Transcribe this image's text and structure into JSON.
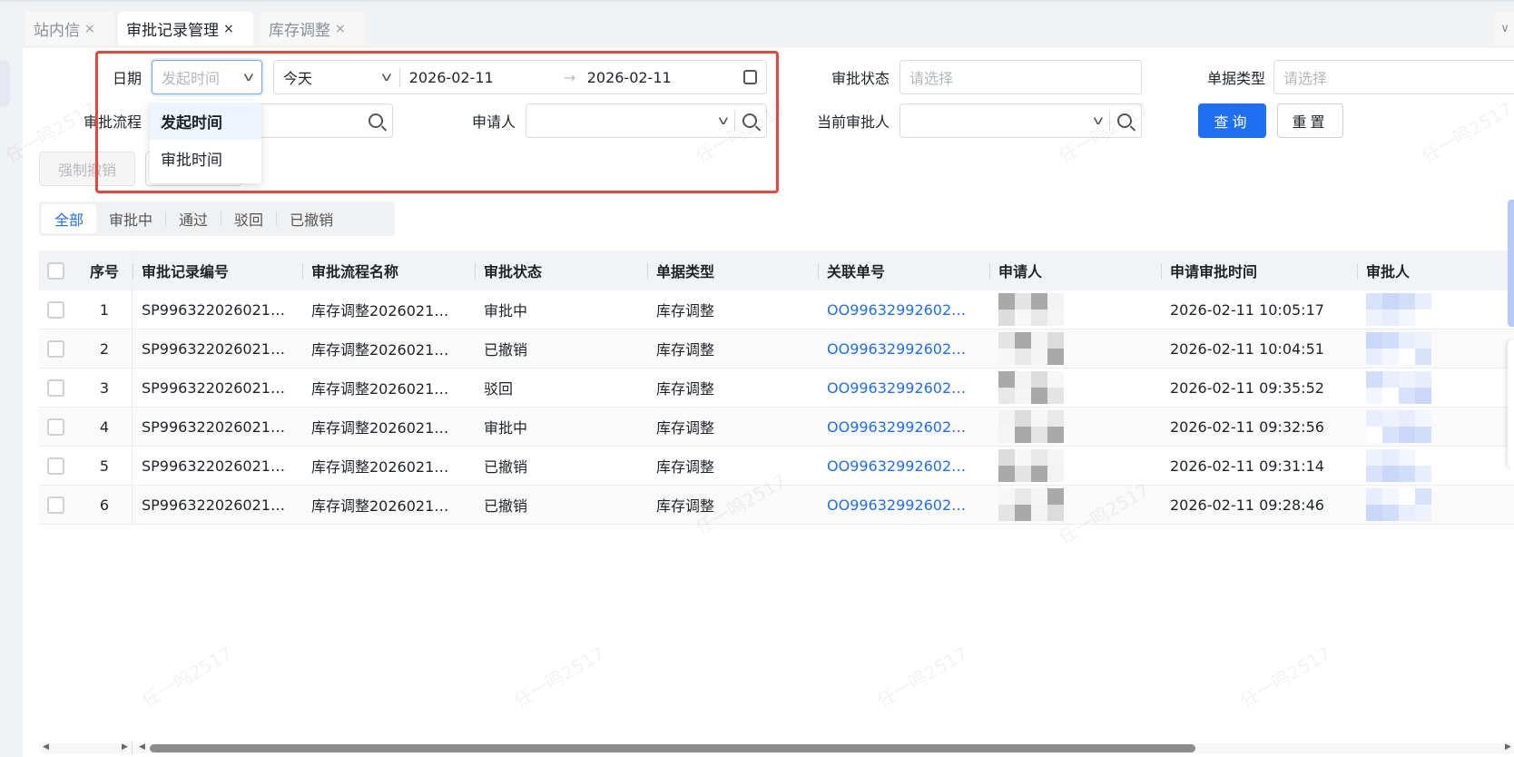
{
  "tabs": [
    {
      "label": "站内信",
      "close": "×"
    },
    {
      "label": "审批记录管理",
      "close": "×",
      "active": true
    },
    {
      "label": "库存调整",
      "close": "×"
    }
  ],
  "filters": {
    "date_label": "日期",
    "date_type_value": "发起时间",
    "date_preset": "今天",
    "date_start": "2026-02-11",
    "date_separator": "→",
    "date_end": "2026-02-11",
    "status_label": "审批状态",
    "status_placeholder": "请选择",
    "doc_type_label": "单据类型",
    "doc_type_placeholder": "请选择",
    "flow_label": "审批流程",
    "applicant_label": "申请人",
    "current_approver_label": "当前审批人",
    "query_label": "查询",
    "reset_label": "重置"
  },
  "dropdown": {
    "options": [
      "发起时间",
      "审批时间"
    ],
    "selected": "发起时间"
  },
  "actions": {
    "force_revoke_label": "强制撤销"
  },
  "status_tabs": [
    "全部",
    "审批中",
    "通过",
    "驳回",
    "已撤销"
  ],
  "table": {
    "columns": [
      "序号",
      "审批记录编号",
      "审批流程名称",
      "审批状态",
      "单据类型",
      "关联单号",
      "申请人",
      "申请审批时间",
      "审批人"
    ],
    "rows": [
      {
        "no": "1",
        "record": "SP996322026021…",
        "flow": "库存调整2026021…",
        "status": "审批中",
        "type": "库存调整",
        "ref": "OO99632992602…",
        "time": "2026-02-11 10:05:17"
      },
      {
        "no": "2",
        "record": "SP996322026021…",
        "flow": "库存调整2026021…",
        "status": "已撤销",
        "type": "库存调整",
        "ref": "OO99632992602…",
        "time": "2026-02-11 10:04:51"
      },
      {
        "no": "3",
        "record": "SP996322026021…",
        "flow": "库存调整2026021…",
        "status": "驳回",
        "type": "库存调整",
        "ref": "OO99632992602…",
        "time": "2026-02-11 09:35:52"
      },
      {
        "no": "4",
        "record": "SP996322026021…",
        "flow": "库存调整2026021…",
        "status": "审批中",
        "type": "库存调整",
        "ref": "OO99632992602…",
        "time": "2026-02-11 09:32:56"
      },
      {
        "no": "5",
        "record": "SP996322026021…",
        "flow": "库存调整2026021…",
        "status": "已撤销",
        "type": "库存调整",
        "ref": "OO99632992602…",
        "time": "2026-02-11 09:31:14"
      },
      {
        "no": "6",
        "record": "SP996322026021…",
        "flow": "库存调整2026021…",
        "status": "已撤销",
        "type": "库存调整",
        "ref": "OO99632992602…",
        "time": "2026-02-11 09:28:46"
      }
    ]
  },
  "watermark": "任一鸣2517",
  "colors": {
    "accent": "#1f6ff0",
    "highlight_box": "#e8453c",
    "header_bg": "#f2f3f5"
  }
}
